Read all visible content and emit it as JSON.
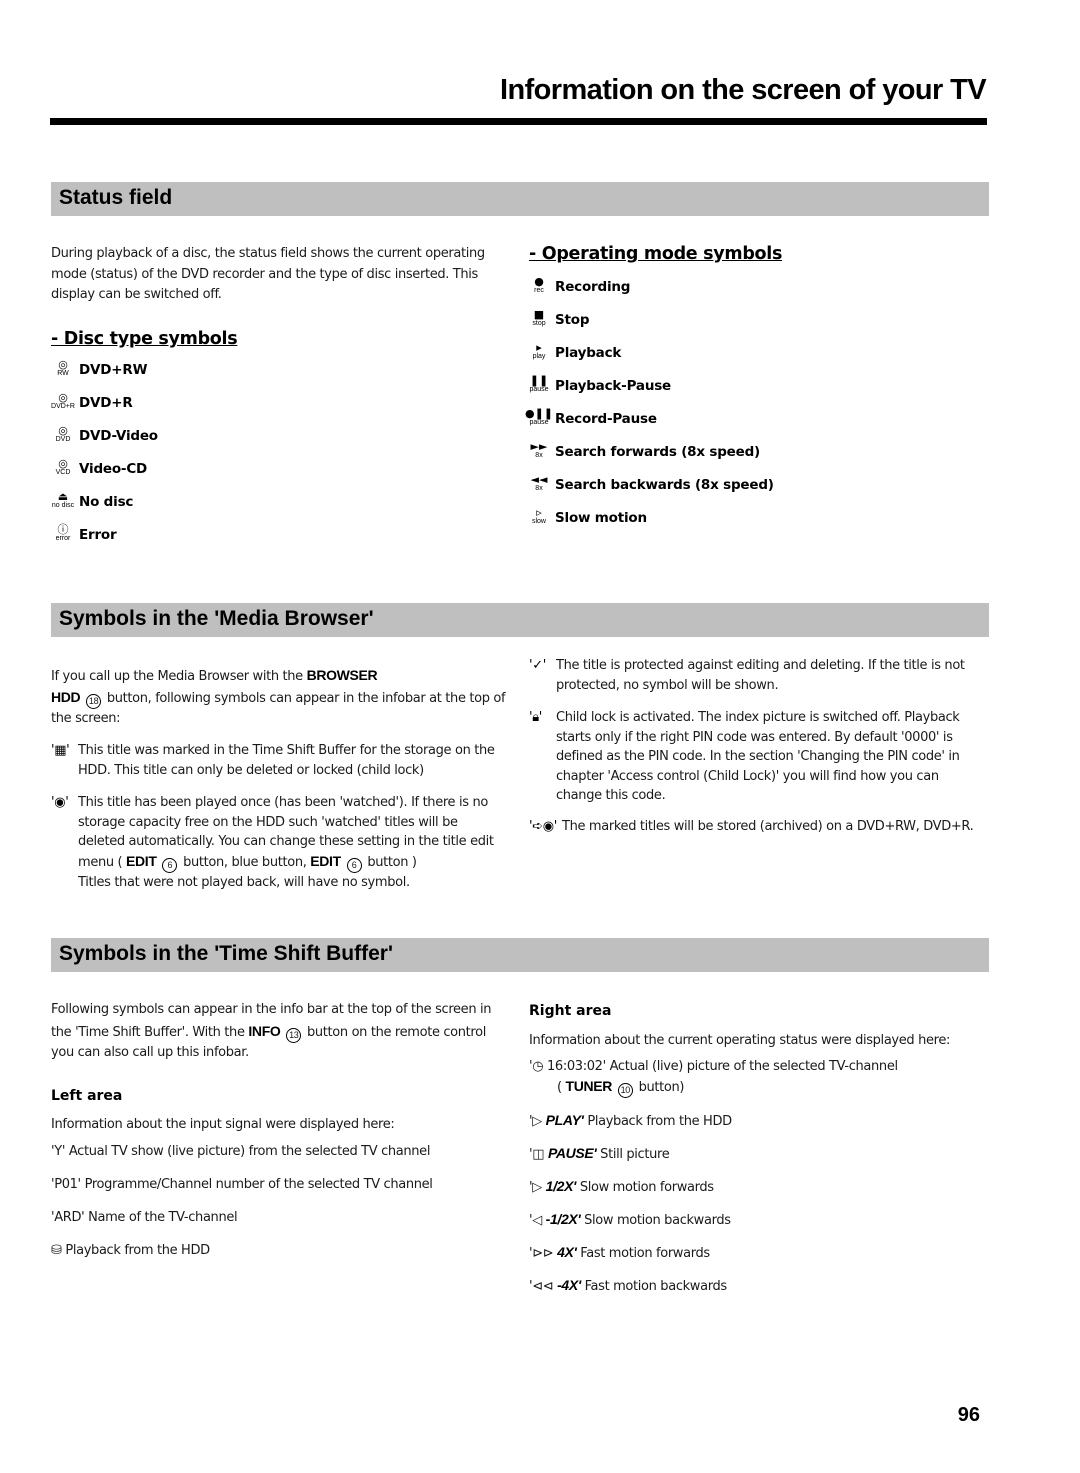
{
  "header": {
    "title": "Information on the screen of your TV"
  },
  "status_field": {
    "heading": "Status field",
    "intro": "During playback of a disc, the status field shows the current operating mode (status) of the DVD recorder and the type of disc inserted. This display can be switched off.",
    "disc_types": {
      "heading": "- Disc type symbols",
      "items": [
        {
          "icon": "disc-icon",
          "glyph": "◎",
          "caption": "RW",
          "label": "DVD+RW"
        },
        {
          "icon": "disc-icon",
          "glyph": "◎",
          "caption": "DVD+R",
          "label": "DVD+R"
        },
        {
          "icon": "disc-icon",
          "glyph": "◎",
          "caption": "DVD",
          "label": "DVD-Video"
        },
        {
          "icon": "disc-icon",
          "glyph": "◎",
          "caption": "VCD",
          "label": "Video-CD"
        },
        {
          "icon": "eject-icon",
          "glyph": "⏏",
          "caption": "no disc",
          "label": "No disc"
        },
        {
          "icon": "error-icon",
          "glyph": "ⓘ",
          "caption": "error",
          "label": "Error"
        }
      ]
    },
    "operating_modes": {
      "heading": "- Operating mode symbols",
      "items": [
        {
          "icon": "record-icon",
          "glyph": "●",
          "caption": "rec",
          "label": "Recording"
        },
        {
          "icon": "stop-icon",
          "glyph": "■",
          "caption": "stop",
          "label": "Stop"
        },
        {
          "icon": "play-icon",
          "glyph": "▸",
          "caption": "play",
          "label": "Playback"
        },
        {
          "icon": "pause-icon",
          "glyph": "❚❚",
          "caption": "pause",
          "label": "Playback-Pause"
        },
        {
          "icon": "record-pause-icon",
          "glyph": "●❚❚",
          "caption": "pause",
          "label": "Record-Pause"
        },
        {
          "icon": "fast-forward-icon",
          "glyph": "►►",
          "caption": "8x",
          "label": "Search forwards (8x speed)"
        },
        {
          "icon": "rewind-icon",
          "glyph": "◄◄",
          "caption": "8x",
          "label": "Search backwards (8x speed)"
        },
        {
          "icon": "slow-motion-icon",
          "glyph": "▹",
          "caption": "slow",
          "label": "Slow motion"
        }
      ]
    }
  },
  "media_browser": {
    "heading": "Symbols in the 'Media Browser'",
    "intro_pre": "If you call up the Media Browser with the ",
    "intro_key1": "BROWSER",
    "intro_key2": "HDD",
    "intro_num": "18",
    "intro_post": " button, following symbols can appear in the infobar at the top of the screen:",
    "tsb_item": {
      "icon": "film-strip-icon",
      "glyph": "'▦'",
      "text": "This title was marked in the Time Shift Buffer for the storage on the HDD. This title can only be deleted or locked (child lock)"
    },
    "watched_item": {
      "icon": "eye-icon",
      "glyph": "'◉'",
      "text": "This title has been played once (has been 'watched'). If there is no storage capacity free on the HDD such 'watched' titles will be deleted automatically. You can change these setting in the title edit",
      "menu_pre": "menu ( ",
      "key": "EDIT",
      "num": "6",
      "menu_mid": " button, blue button, ",
      "menu_post": " button )",
      "note": "Titles that were not played back, will have no symbol."
    },
    "protected_item": {
      "icon": "checkmark-icon",
      "glyph": "'✓'",
      "text": "The title is protected against editing and deleting. If the title is not protected, no symbol will be shown."
    },
    "childlock_item": {
      "icon": "lock-icon",
      "glyph": "'🔒︎'",
      "text": "Child lock is activated. The index picture is switched off. Playback starts only if the right PIN code was entered. By default '0000' is defined as the PIN code. In the section 'Changing the PIN code' in chapter 'Access control (Child Lock)' you will find how you can change this code."
    },
    "archive_item": {
      "icon": "archive-disc-icon",
      "glyph": "'➪◉'",
      "text": "The marked titles will be stored (archived) on a DVD+RW, DVD+R."
    }
  },
  "time_shift": {
    "heading": "Symbols in the 'Time Shift Buffer'",
    "intro_pre": "Following symbols can appear in the info bar at the top of the screen in the 'Time Shift Buffer'. With the ",
    "intro_key": "INFO",
    "intro_num": "13",
    "intro_post": " button on the remote control you can also call up this infobar.",
    "left": {
      "heading": "Left area",
      "intro": "Information about the input signal were displayed here:",
      "items": [
        {
          "icon": "antenna-icon",
          "prefix": "'Y'",
          "text": " Actual TV show (live picture) from the selected TV channel"
        },
        {
          "icon": "",
          "prefix": "'P01'",
          "text": " Programme/Channel number of the selected TV channel"
        },
        {
          "icon": "",
          "prefix": "'ARD'",
          "text": " Name of the TV-channel"
        },
        {
          "icon": "hdd-icon",
          "prefix": "⛁",
          "text": " Playback from the HDD"
        }
      ]
    },
    "right": {
      "heading": "Right area",
      "intro": "Information about the current operating status were displayed here:",
      "clock_item": {
        "prefix": "'◷ 16:03:02'",
        "text": " Actual (live) picture of the selected TV-channel",
        "key": "TUNER",
        "num": "10",
        "post": " button)"
      },
      "items": [
        {
          "icon": "play-icon",
          "glyph": "'▷ ",
          "code": "PLAY'",
          "text": " Playback from the HDD"
        },
        {
          "icon": "pause-icon",
          "glyph": "'◫ ",
          "code": "PAUSE'",
          "text": " Still picture"
        },
        {
          "icon": "slow-forward-icon",
          "glyph": "'▷ ",
          "code": "1/2X'",
          "text": " Slow motion forwards"
        },
        {
          "icon": "slow-backward-icon",
          "glyph": "'◁ ",
          "code": "-1/2X'",
          "text": " Slow motion backwards"
        },
        {
          "icon": "fast-forward-icon",
          "glyph": "'⊳⊳ ",
          "code": "4X'",
          "text": " Fast motion forwards"
        },
        {
          "icon": "fast-backward-icon",
          "glyph": "'⊲⊲ ",
          "code": "-4X'",
          "text": " Fast motion backwards"
        }
      ]
    }
  },
  "footer": {
    "page_number": "96"
  }
}
